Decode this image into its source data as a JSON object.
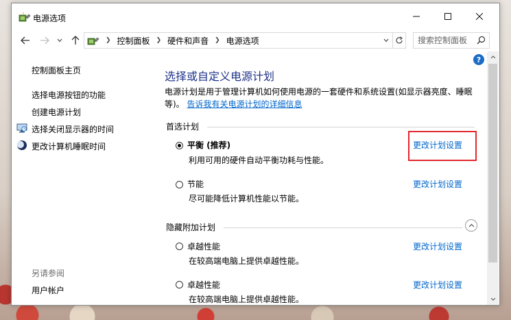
{
  "window": {
    "title": "电源选项"
  },
  "address": {
    "crumbs": [
      "控制面板",
      "硬件和声音",
      "电源选项"
    ],
    "search_placeholder": "搜索控制面板"
  },
  "sidebar": {
    "home": "控制面板主页",
    "items": [
      {
        "label": "选择电源按钮的功能",
        "icon": ""
      },
      {
        "label": "创建电源计划",
        "icon": ""
      },
      {
        "label": "选择关闭显示器的时间",
        "icon": "monitor-icon"
      },
      {
        "label": "更改计算机睡眠时间",
        "icon": "moon-icon"
      }
    ],
    "see_also_label": "另请参阅",
    "see_also_items": [
      "用户帐户"
    ]
  },
  "main": {
    "title": "选择或自定义电源计划",
    "description": "电源计划是用于管理计算机如何使用电源的一套硬件和系统设置(如显示器亮度、睡眠等)。",
    "description_line1": "电源计划是用于管理计算机如何使用电源的一套硬件和系统设置(如显示器亮度、睡眠",
    "description_line2_prefix": "等)。",
    "description_link": "告诉我有关电源计划的详细信息",
    "preferred_label": "首选计划",
    "hidden_label": "隐藏附加计划",
    "change_settings_label": "更改计划设置",
    "preferred_plans": [
      {
        "name": "平衡 (推荐)",
        "desc": "利用可用的硬件自动平衡功耗与性能。",
        "selected": true
      },
      {
        "name": "节能",
        "desc": "尽可能降低计算机性能以节能。",
        "selected": false
      }
    ],
    "hidden_plans": [
      {
        "name": "卓越性能",
        "desc": "在较高端电脑上提供卓越性能。",
        "selected": false
      },
      {
        "name": "卓越性能",
        "desc": "在较高端电脑上提供卓越性能。",
        "selected": false
      }
    ]
  },
  "colors": {
    "title_blue": "#1e3287",
    "link_blue": "#0066cc",
    "highlight_red": "#e2262b"
  }
}
